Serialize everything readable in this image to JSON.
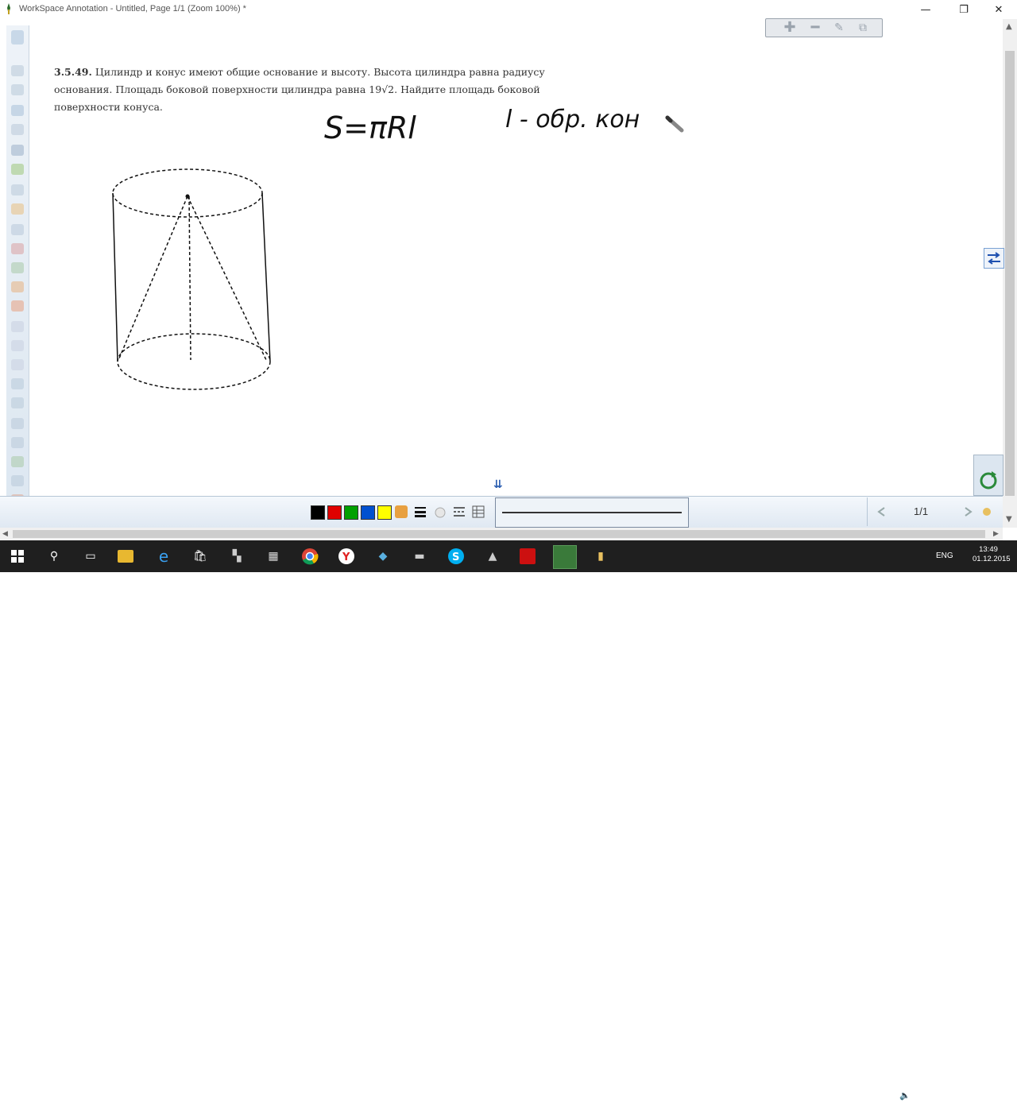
{
  "window": {
    "title": "WorkSpace Annotation - Untitled, Page 1/1  (Zoom 100%) *",
    "minimize": "—",
    "maximize": "❐",
    "close": "✕"
  },
  "problem": {
    "number": "3.5.49.",
    "text": "Цилиндр и конус имеют общие основание и высоту. Высота цилиндра равна радиусу основания. Площадь боковой поверхности цилиндра равна 19√2. Найдите площадь боковой поверхности конуса."
  },
  "handwriting": {
    "formula": "S=πRl",
    "note": "l - обр. кон"
  },
  "colors": {
    "palette": [
      "#000000",
      "#e00000",
      "#00a000",
      "#0050d0",
      "#ffff00"
    ],
    "accent": "#2a5db0"
  },
  "pager": {
    "page": "1/1"
  },
  "taskbar": {
    "lang": "ENG",
    "time": "13:49",
    "date": "01.12.2015"
  }
}
